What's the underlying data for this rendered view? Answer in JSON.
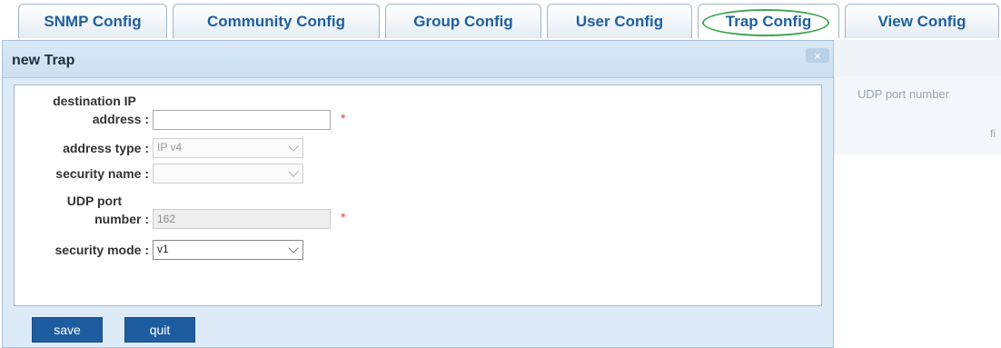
{
  "tabs": [
    {
      "label": "SNMP Config"
    },
    {
      "label": "Community Config"
    },
    {
      "label": "Group Config"
    },
    {
      "label": "User Config"
    },
    {
      "label": "Trap Config"
    },
    {
      "label": "View Config"
    }
  ],
  "active_tab_label": "Trap Config",
  "background": {
    "udp_label": "UDP port number",
    "truncated_text": "fi"
  },
  "dialog": {
    "title": "new Trap",
    "close_glyph": "×",
    "fields": {
      "dest_ip": {
        "label_line1": "destination IP",
        "label_line2": "address :",
        "value": "",
        "required_mark": "*"
      },
      "address_type": {
        "label": "address type :",
        "value": "IP v4"
      },
      "security_name": {
        "label": "security name :",
        "value": ""
      },
      "udp_port": {
        "label_line1": "UDP port",
        "label_line2": "number :",
        "value": "162",
        "required_mark": "*"
      },
      "security_mode": {
        "label": "security mode :",
        "value": "v1"
      }
    },
    "buttons": {
      "save": "save",
      "quit": "quit"
    }
  },
  "colors": {
    "tab_text": "#1f5f9e",
    "highlight_ring": "#3fa84f",
    "button_bg": "#1d5d9f",
    "dialog_bg": "#dcebf7",
    "required": "#e0413c"
  }
}
